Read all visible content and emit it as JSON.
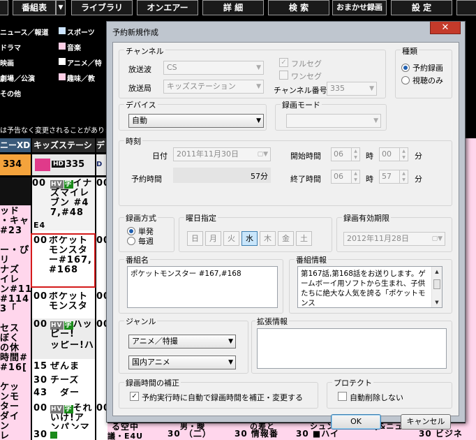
{
  "toolbar": {
    "items": [
      "番組表",
      "ライブラリ",
      "オンエアー",
      "詳 細",
      "検 索",
      "おまかせ録画",
      "設 定"
    ],
    "dropdown_glyph": "▼"
  },
  "legend": [
    {
      "label": "ニュース／報道",
      "color": "#ffffff"
    },
    {
      "label": "スポーツ",
      "color": "#cce4ff"
    },
    {
      "label": "ドラマ",
      "color": "#ffffff"
    },
    {
      "label": "音楽",
      "color": "#ffcfe6"
    },
    {
      "label": "映画",
      "color": "#ffffff"
    },
    {
      "label": "アニメ／特",
      "color": "#ffffff"
    },
    {
      "label": "劇場／公演",
      "color": "#ffffff"
    },
    {
      "label": "趣味／教",
      "color": "#ffcfe6"
    },
    {
      "label": "その他",
      "color": "#ffffff"
    }
  ],
  "notice": "は予告なく変更されることがありま",
  "channels": {
    "headers": [
      "ニーXD",
      "キッズステーシ",
      "デ"
    ],
    "numbers": [
      "334",
      "335",
      "D"
    ],
    "logo": "HD"
  },
  "grid": {
    "col1": [
      "ッド",
      "・キャ",
      "#23",
      "",
      "ー・ぴ",
      "リ",
      "ナズ",
      "イレ",
      "ン#11",
      "#114",
      "3「",
      "",
      "セス",
      "ぼく",
      "の休",
      "時間#",
      "#16[",
      "",
      "ケッ",
      "ンモ",
      "ター",
      "ダイ",
      "ン",
      "レ",
      "ノ"
    ],
    "col2_times": [
      "00",
      "00",
      "00",
      "00",
      "15",
      "30",
      "43",
      "00",
      "30"
    ],
    "col2_hv": "HV",
    "col2_ji": "字",
    "col2_prog1": "イナズマイレブン #47,#48",
    "col2_prog1_suffix": "E4",
    "col2_prog2": "ポケットモンスター#167,#168",
    "col2_prog3": "ポケットモンスタ",
    "col2_prog4": "ハッピー!",
    "col2_prog4_line2": "ッピー!ハ",
    "col2_prog5": "ぜんま",
    "col2_prog6": "チーズ",
    "col2_prog7": "ダー",
    "col2_prog8": "それいけ!アンパンマン",
    "col3_times": [
      "00",
      "00",
      "00",
      "00",
      "00"
    ],
    "bottom_row": [
      "る空中",
      "30 （二）",
      "30 情報番",
      "30 ■ハイ",
      "30 ビジネ"
    ],
    "bottom_row2": [
      "男・曖",
      "の差と",
      "シュン",
      "j&ニュ",
      "ニュー",
      "議・E4U"
    ]
  },
  "dialog": {
    "title": "予約新規作成",
    "close_glyph": "✕",
    "channel": {
      "group": "チャンネル",
      "broadcast_label": "放送波",
      "broadcast_value": "CS",
      "station_label": "放送局",
      "station_value": "キッズステーション",
      "fullseg_label": "フルセグ",
      "oneseg_label": "ワンセグ",
      "chnum_label": "チャンネル番号",
      "chnum_value": "335"
    },
    "kind": {
      "group": "種類",
      "opt_record": "予約録画",
      "opt_watch": "視聴のみ"
    },
    "device": {
      "group": "デバイス",
      "value": "自動"
    },
    "mode": {
      "group": "録画モード",
      "value": ""
    },
    "time": {
      "group": "時刻",
      "date_label": "日付",
      "date_value": "2011年11月30日",
      "start_label": "開始時間",
      "start_h": "06",
      "start_m": "00",
      "end_label": "終了時間",
      "end_h": "06",
      "end_m": "57",
      "hour_unit": "時",
      "min_unit": "分",
      "duration_label": "予約時間",
      "duration_value": "57分"
    },
    "method": {
      "group": "録画方式",
      "once": "単発",
      "weekly": "毎週"
    },
    "weekday": {
      "group": "曜日指定",
      "days": [
        "日",
        "月",
        "火",
        "水",
        "木",
        "金",
        "土"
      ],
      "selected_index": 3
    },
    "expiry": {
      "group": "録画有効期限",
      "value": "2012年11月28日"
    },
    "program": {
      "group": "番組名",
      "value": "ポケットモンスター #167,#168"
    },
    "info": {
      "group": "番組情報",
      "value": "第167話,第168話をお送りします。ゲームボーイ用ソフトから生まれ、子供たちに絶大な人気を誇る「ポケットモンス"
    },
    "genre": {
      "group": "ジャンル",
      "main": "アニメ／特撮",
      "sub": "国内アニメ"
    },
    "ext": {
      "group": "拡張情報",
      "value": ""
    },
    "correction": {
      "group": "録画時間の補正",
      "label": "予約実行時に自動で録画時間を補正・変更する",
      "checked": true
    },
    "protect": {
      "group": "プロテクト",
      "label": "自動削除しない",
      "checked": false
    },
    "ok": "OK",
    "cancel": "キャンセル"
  }
}
